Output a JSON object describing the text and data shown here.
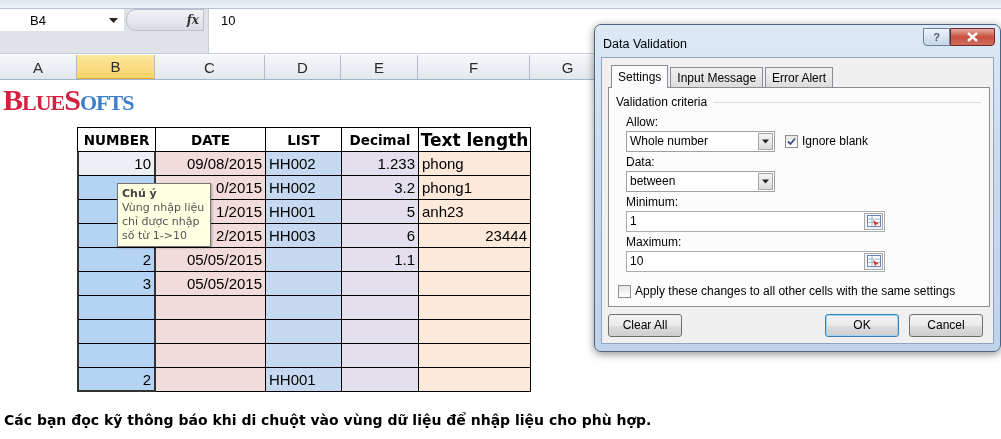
{
  "formula_bar": {
    "name_box": "B4",
    "function_label": "fx",
    "formula": "10"
  },
  "column_headers": [
    {
      "label": "A",
      "selected": false
    },
    {
      "label": "B",
      "selected": true
    },
    {
      "label": "C",
      "selected": false
    },
    {
      "label": "D",
      "selected": false
    },
    {
      "label": "E",
      "selected": false
    },
    {
      "label": "F",
      "selected": false
    },
    {
      "label": "G",
      "selected": false
    }
  ],
  "logo": "BLUESOFTS",
  "table": {
    "columns": [
      {
        "label": "NUMBER",
        "color": "#b5d3f3"
      },
      {
        "label": "DATE",
        "color": "#f2dcdb"
      },
      {
        "label": "LIST",
        "color": "#c5d9f1"
      },
      {
        "label": "Decimal",
        "color": "#e4dfec"
      },
      {
        "label": "Text length",
        "color": "#fde9d9"
      }
    ],
    "rows": [
      [
        {
          "text": "10",
          "kind": "number",
          "selected": true,
          "active": true
        },
        {
          "text": "09/08/2015",
          "kind": "number",
          "selected": false,
          "active": false
        },
        {
          "text": "HH002",
          "kind": "text",
          "selected": false,
          "active": false
        },
        {
          "text": "1.233",
          "kind": "number",
          "selected": false,
          "active": false
        },
        {
          "text": "phong",
          "kind": "text",
          "selected": false,
          "active": false
        }
      ],
      [
        {
          "kind": "empty",
          "selected": true,
          "active": false
        },
        {
          "text": "0/2015",
          "kind": "number",
          "selected": false,
          "active": false
        },
        {
          "text": "HH002",
          "kind": "text",
          "selected": false,
          "active": false
        },
        {
          "text": "3.2",
          "kind": "number",
          "selected": false,
          "active": false
        },
        {
          "text": "phong1",
          "kind": "text",
          "selected": false,
          "active": false
        }
      ],
      [
        {
          "kind": "empty",
          "selected": true,
          "active": false
        },
        {
          "text": "1/2015",
          "kind": "number",
          "selected": false,
          "active": false
        },
        {
          "text": "HH001",
          "kind": "text",
          "selected": false,
          "active": false
        },
        {
          "text": "5",
          "kind": "number",
          "selected": false,
          "active": false
        },
        {
          "text": "anh23",
          "kind": "text",
          "selected": false,
          "active": false
        }
      ],
      [
        {
          "kind": "empty",
          "selected": true,
          "active": false
        },
        {
          "text": "2/2015",
          "kind": "number",
          "selected": false,
          "active": false
        },
        {
          "text": "HH003",
          "kind": "text",
          "selected": false,
          "active": false
        },
        {
          "text": "6",
          "kind": "number",
          "selected": false,
          "active": false
        },
        {
          "text": "23444",
          "kind": "number",
          "selected": false,
          "active": false
        }
      ],
      [
        {
          "text": "2",
          "kind": "number",
          "selected": true,
          "active": false
        },
        {
          "text": "05/05/2015",
          "kind": "number",
          "selected": false,
          "active": false
        },
        {
          "kind": "empty",
          "selected": false,
          "active": false
        },
        {
          "text": "1.1",
          "kind": "number",
          "selected": false,
          "active": false
        },
        {
          "kind": "empty",
          "selected": false,
          "active": false
        }
      ],
      [
        {
          "text": "3",
          "kind": "number",
          "selected": true,
          "active": false
        },
        {
          "text": "05/05/2015",
          "kind": "number",
          "selected": false,
          "active": false
        },
        {
          "kind": "empty",
          "selected": false,
          "active": false
        },
        {
          "kind": "empty",
          "selected": false,
          "active": false
        },
        {
          "kind": "empty",
          "selected": false,
          "active": false
        }
      ],
      [
        {
          "kind": "empty",
          "selected": true,
          "active": false
        },
        {
          "kind": "empty",
          "selected": false,
          "active": false
        },
        {
          "kind": "empty",
          "selected": false,
          "active": false
        },
        {
          "kind": "empty",
          "selected": false,
          "active": false
        },
        {
          "kind": "empty",
          "selected": false,
          "active": false
        }
      ],
      [
        {
          "kind": "empty",
          "selected": true,
          "active": false
        },
        {
          "kind": "empty",
          "selected": false,
          "active": false
        },
        {
          "kind": "empty",
          "selected": false,
          "active": false
        },
        {
          "kind": "empty",
          "selected": false,
          "active": false
        },
        {
          "kind": "empty",
          "selected": false,
          "active": false
        }
      ],
      [
        {
          "kind": "empty",
          "selected": true,
          "active": false
        },
        {
          "kind": "empty",
          "selected": false,
          "active": false
        },
        {
          "kind": "empty",
          "selected": false,
          "active": false
        },
        {
          "kind": "empty",
          "selected": false,
          "active": false
        },
        {
          "kind": "empty",
          "selected": false,
          "active": false
        }
      ],
      [
        {
          "text": "2",
          "kind": "number",
          "selected": true,
          "active": false
        },
        {
          "kind": "empty",
          "selected": false,
          "active": false
        },
        {
          "text": "HH001",
          "kind": "text",
          "selected": false,
          "active": false
        },
        {
          "kind": "empty",
          "selected": false,
          "active": false
        },
        {
          "kind": "empty",
          "selected": false,
          "active": false
        }
      ]
    ]
  },
  "tooltip": {
    "title": "Chú ý",
    "body": "Vùng nhập liệu\nchỉ được nhập\nsố từ 1->10"
  },
  "dialog": {
    "title": "Data Validation",
    "help_label": "?",
    "tabs": [
      {
        "label": "Settings",
        "selected": true
      },
      {
        "label": "Input Message",
        "selected": false
      },
      {
        "label": "Error Alert",
        "selected": false
      }
    ],
    "group_label": "Validation criteria",
    "allow": {
      "label": "Allow:",
      "value": "Whole number"
    },
    "ignore_blank": {
      "label": "Ignore blank",
      "checked": true
    },
    "data": {
      "label": "Data:",
      "value": "between"
    },
    "minimum": {
      "label": "Minimum:",
      "value": "1"
    },
    "maximum": {
      "label": "Maximum:",
      "value": "10"
    },
    "apply_all": {
      "label": "Apply these changes to all other cells with the same settings",
      "checked": false
    },
    "buttons": [
      {
        "label": "Clear All",
        "focused": false
      },
      {
        "label": "OK",
        "focused": true
      },
      {
        "label": "Cancel",
        "focused": false
      }
    ]
  },
  "note": "Các bạn đọc kỹ thông báo khi di chuột vào vùng dữ liệu để nhập liệu cho phù hợp."
}
